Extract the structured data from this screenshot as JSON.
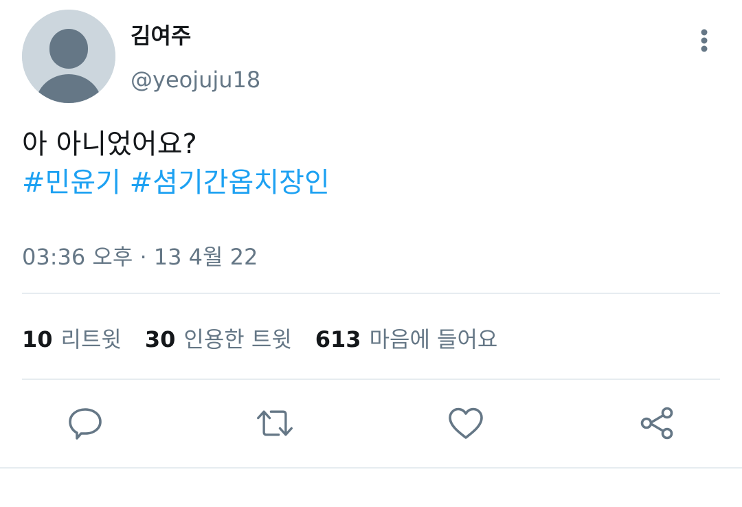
{
  "user": {
    "display_name": "김여주",
    "handle": "@yeojuju18"
  },
  "tweet": {
    "text": "아 아니었어요?",
    "hashtags": [
      "#민윤기",
      "#셤기간옵치장인"
    ],
    "timestamp": "03:36 오후 · 13 4월 22"
  },
  "stats": [
    {
      "count": "10",
      "label": "리트윗"
    },
    {
      "count": "30",
      "label": "인용한 트윗"
    },
    {
      "count": "613",
      "label": "마음에 들어요"
    }
  ],
  "icons": {
    "more": "more-vertical-icon",
    "reply": "reply-icon",
    "retweet": "retweet-icon",
    "like": "heart-icon",
    "share": "share-icon"
  },
  "colors": {
    "accent": "#1da1f2",
    "secondary_text": "#657786",
    "divider": "#e6ecf0",
    "avatar_bg": "#ccd6dd",
    "avatar_figure": "#657786"
  }
}
